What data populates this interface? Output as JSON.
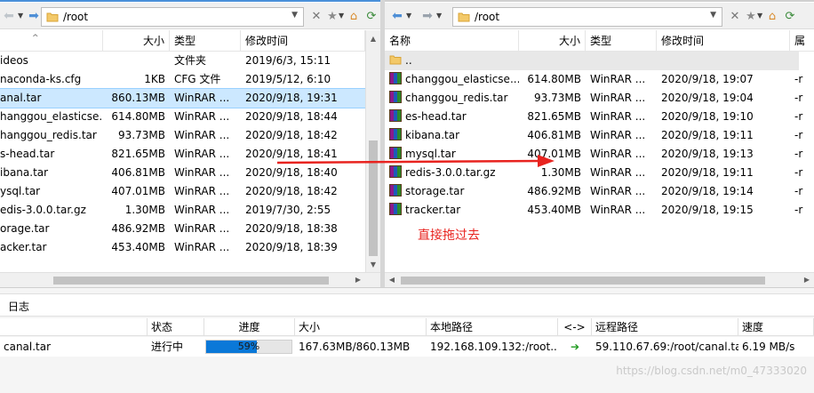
{
  "left": {
    "path": "/root",
    "columns": [
      "",
      "大小",
      "类型",
      "修改时间"
    ],
    "rows": [
      {
        "name": "ideos",
        "size": "",
        "type": "文件夹",
        "mtime": "2019/6/3, 15:11"
      },
      {
        "name": "naconda-ks.cfg",
        "size": "1KB",
        "type": "CFG 文件",
        "mtime": "2019/5/12, 6:10"
      },
      {
        "name": "anal.tar",
        "size": "860.13MB",
        "type": "WinRAR ...",
        "mtime": "2020/9/18, 19:31"
      },
      {
        "name": "hanggou_elasticse...",
        "size": "614.80MB",
        "type": "WinRAR ...",
        "mtime": "2020/9/18, 18:44"
      },
      {
        "name": "hanggou_redis.tar",
        "size": "93.73MB",
        "type": "WinRAR ...",
        "mtime": "2020/9/18, 18:42"
      },
      {
        "name": "s-head.tar",
        "size": "821.65MB",
        "type": "WinRAR ...",
        "mtime": "2020/9/18, 18:41"
      },
      {
        "name": "ibana.tar",
        "size": "406.81MB",
        "type": "WinRAR ...",
        "mtime": "2020/9/18, 18:40"
      },
      {
        "name": "ysql.tar",
        "size": "407.01MB",
        "type": "WinRAR ...",
        "mtime": "2020/9/18, 18:42"
      },
      {
        "name": "edis-3.0.0.tar.gz",
        "size": "1.30MB",
        "type": "WinRAR ...",
        "mtime": "2019/7/30, 2:55"
      },
      {
        "name": "orage.tar",
        "size": "486.92MB",
        "type": "WinRAR ...",
        "mtime": "2020/9/18, 18:38"
      },
      {
        "name": "acker.tar",
        "size": "453.40MB",
        "type": "WinRAR ...",
        "mtime": "2020/9/18, 18:39"
      }
    ]
  },
  "right": {
    "path": "/root",
    "columns": [
      "名称",
      "大小",
      "类型",
      "修改时间",
      "属"
    ],
    "parent_row": "..",
    "rows": [
      {
        "name": "changgou_elasticse...",
        "size": "614.80MB",
        "type": "WinRAR ...",
        "mtime": "2020/9/18, 19:07",
        "attr": "-r"
      },
      {
        "name": "changgou_redis.tar",
        "size": "93.73MB",
        "type": "WinRAR ...",
        "mtime": "2020/9/18, 19:04",
        "attr": "-r"
      },
      {
        "name": "es-head.tar",
        "size": "821.65MB",
        "type": "WinRAR ...",
        "mtime": "2020/9/18, 19:10",
        "attr": "-r"
      },
      {
        "name": "kibana.tar",
        "size": "406.81MB",
        "type": "WinRAR ...",
        "mtime": "2020/9/18, 19:11",
        "attr": "-r"
      },
      {
        "name": "mysql.tar",
        "size": "407.01MB",
        "type": "WinRAR ...",
        "mtime": "2020/9/18, 19:13",
        "attr": "-r"
      },
      {
        "name": "redis-3.0.0.tar.gz",
        "size": "1.30MB",
        "type": "WinRAR ...",
        "mtime": "2020/9/18, 19:11",
        "attr": "-r"
      },
      {
        "name": "storage.tar",
        "size": "486.92MB",
        "type": "WinRAR ...",
        "mtime": "2020/9/18, 19:14",
        "attr": "-r"
      },
      {
        "name": "tracker.tar",
        "size": "453.40MB",
        "type": "WinRAR ...",
        "mtime": "2020/9/18, 19:15",
        "attr": "-r"
      }
    ]
  },
  "annotation": "直接拖过去",
  "log": {
    "tab_label": "日志",
    "columns": [
      "",
      "状态",
      "进度",
      "大小",
      "本地路径",
      "<->",
      "远程路径",
      "速度"
    ],
    "transfer": {
      "file": "canal.tar",
      "status": "进行中",
      "progress_percent": 59,
      "progress_label": "59%",
      "size": "167.63MB/860.13MB",
      "local_path": "192.168.109.132:/root...",
      "direction": "➔",
      "remote_path": "59.110.67.69:/root/canal.tar",
      "speed": "6.19 MB/s"
    }
  },
  "watermark": "https://blog.csdn.net/m0_47333020",
  "colors": {
    "accent": "#0a78d8",
    "selection": "#cce8ff",
    "annotation": "#e8231f",
    "arrow": "#e8231f"
  },
  "icons": {
    "back": "left-arrow-icon",
    "forward": "right-arrow-icon",
    "folder": "folder-icon",
    "clear": "close-icon",
    "bookmark": "star-icon",
    "home": "home-icon",
    "refresh": "refresh-icon",
    "archive": "winrar-archive-icon"
  }
}
